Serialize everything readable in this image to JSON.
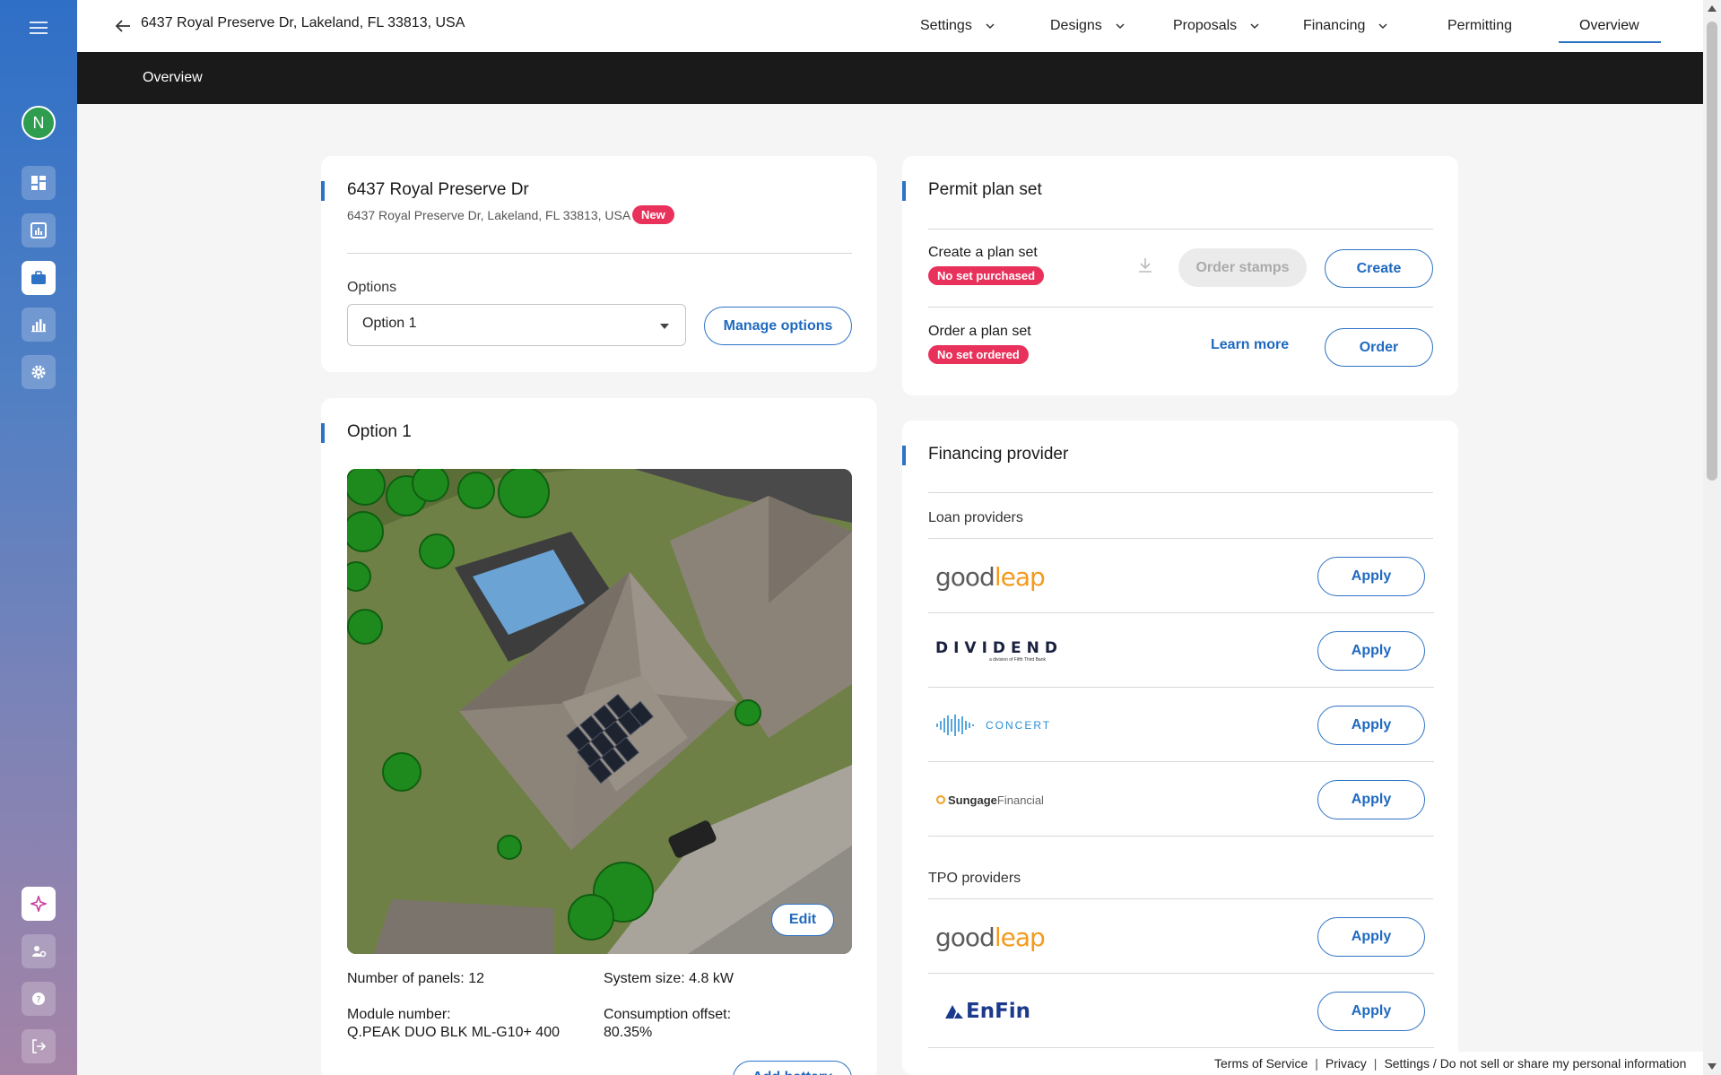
{
  "sidebar": {
    "avatar_initial": "N",
    "items": [
      {
        "name": "dashboard-icon"
      },
      {
        "name": "reports-icon"
      },
      {
        "name": "projects-icon"
      },
      {
        "name": "analytics-icon"
      },
      {
        "name": "settings-icon"
      }
    ],
    "bottom_items": [
      {
        "name": "ai-assistant-icon"
      },
      {
        "name": "team-icon"
      },
      {
        "name": "help-icon"
      },
      {
        "name": "logout-icon"
      }
    ]
  },
  "header": {
    "address": "6437 Royal Preserve Dr, Lakeland, FL 33813, USA",
    "nav": [
      {
        "label": "Settings",
        "has_menu": true
      },
      {
        "label": "Designs",
        "has_menu": true
      },
      {
        "label": "Proposals",
        "has_menu": true
      },
      {
        "label": "Financing",
        "has_menu": true
      },
      {
        "label": "Permitting",
        "has_menu": false
      },
      {
        "label": "Overview",
        "has_menu": false,
        "active": true
      }
    ]
  },
  "subheader": {
    "title": "Overview"
  },
  "project_card": {
    "title": "6437 Royal Preserve Dr",
    "address": "6437 Royal Preserve Dr, Lakeland, FL 33813, USA",
    "badge": "New",
    "options_label": "Options",
    "selected_option": "Option 1",
    "manage_options": "Manage options"
  },
  "option_card": {
    "title": "Option 1",
    "edit": "Edit",
    "panels_label": "Number of panels:",
    "panels_value": "12",
    "system_size_label": "System size:",
    "system_size_value": "4.8 kW",
    "module_label": "Module number:",
    "module_value": "Q.PEAK DUO BLK ML-G10+ 400",
    "offset_label": "Consumption offset:",
    "offset_value": "80.35%",
    "add_battery": "Add battery"
  },
  "permit_card": {
    "title": "Permit plan set",
    "create_title": "Create a plan set",
    "create_badge": "No set purchased",
    "order_stamps": "Order stamps",
    "create_button": "Create",
    "order_title": "Order a plan set",
    "order_badge": "No set ordered",
    "learn_more": "Learn more",
    "order_button": "Order"
  },
  "financing_card": {
    "title": "Financing provider",
    "loan_label": "Loan providers",
    "tpo_label": "TPO providers",
    "apply": "Apply",
    "loan_providers": [
      {
        "name": "goodleap"
      },
      {
        "name": "DIVIDEND",
        "tagline": "a division of Fifth Third Bank"
      },
      {
        "name": "CONCERT"
      },
      {
        "name": "Sungage",
        "suffix": "Financial"
      }
    ],
    "tpo_providers": [
      {
        "name": "goodleap"
      },
      {
        "name": "EnFin"
      }
    ]
  },
  "footer": {
    "terms": "Terms of Service",
    "privacy": "Privacy",
    "settings": "Settings / Do not sell or share my personal information"
  },
  "colors": {
    "accent": "#2d73c5",
    "badge_red": "#e8325c",
    "avatar_green": "#2e9d4f"
  }
}
